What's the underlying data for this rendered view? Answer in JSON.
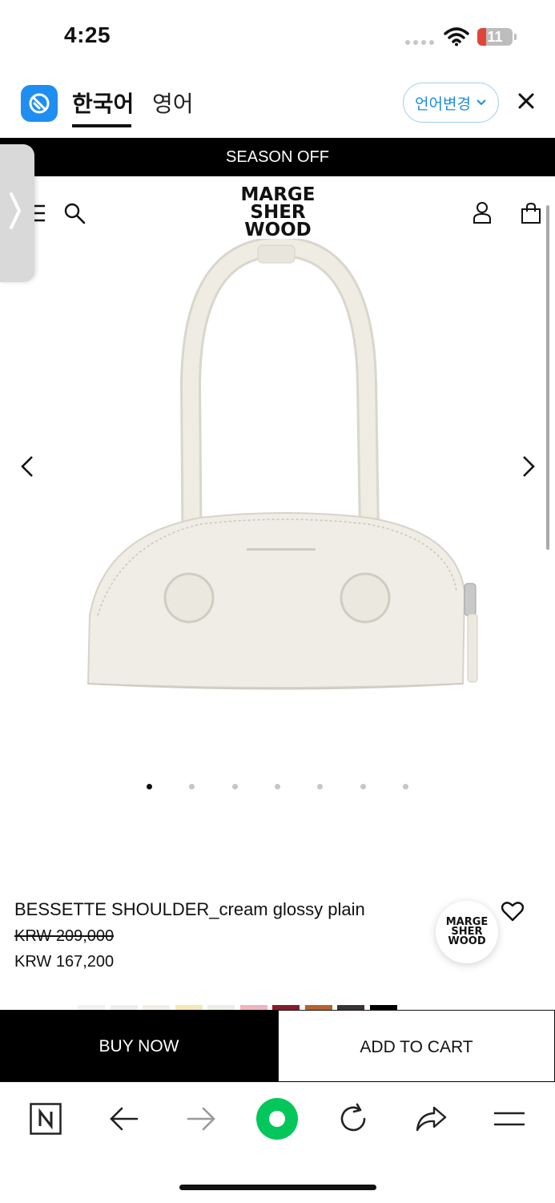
{
  "status_bar": {
    "time": "4:25",
    "battery": "11"
  },
  "translate_bar": {
    "tabs": [
      {
        "label": "한국어",
        "active": true
      },
      {
        "label": "영어",
        "active": false
      }
    ],
    "language_button": "언어변경",
    "colors": {
      "accent": "#1b8be0"
    }
  },
  "store": {
    "banner": "SEASON OFF",
    "logo_lines": [
      "MARGE",
      "SHER",
      "WOOD"
    ]
  },
  "carousel": {
    "slide_count": 7,
    "active_index": 0
  },
  "product": {
    "name": "BESSETTE SHOULDER_cream glossy plain",
    "original_price": "KRW 209,000",
    "sale_price": "KRW 167,200",
    "swatches": [
      "#f2f2f2",
      "#eeeeee",
      "#f4efe6",
      "#f6e7b7",
      "#e9efe6",
      "#f1b3bf",
      "#8a1b2b",
      "#b8612a",
      "#3b3331",
      "#000000"
    ]
  },
  "actions": {
    "buy_now": "BUY NOW",
    "add_to_cart": "ADD TO CART"
  },
  "browser_toolbar": {
    "icons": [
      "naver-icon",
      "back-icon",
      "forward-icon",
      "green-dot-icon",
      "reload-icon",
      "share-icon",
      "menu-icon"
    ]
  }
}
